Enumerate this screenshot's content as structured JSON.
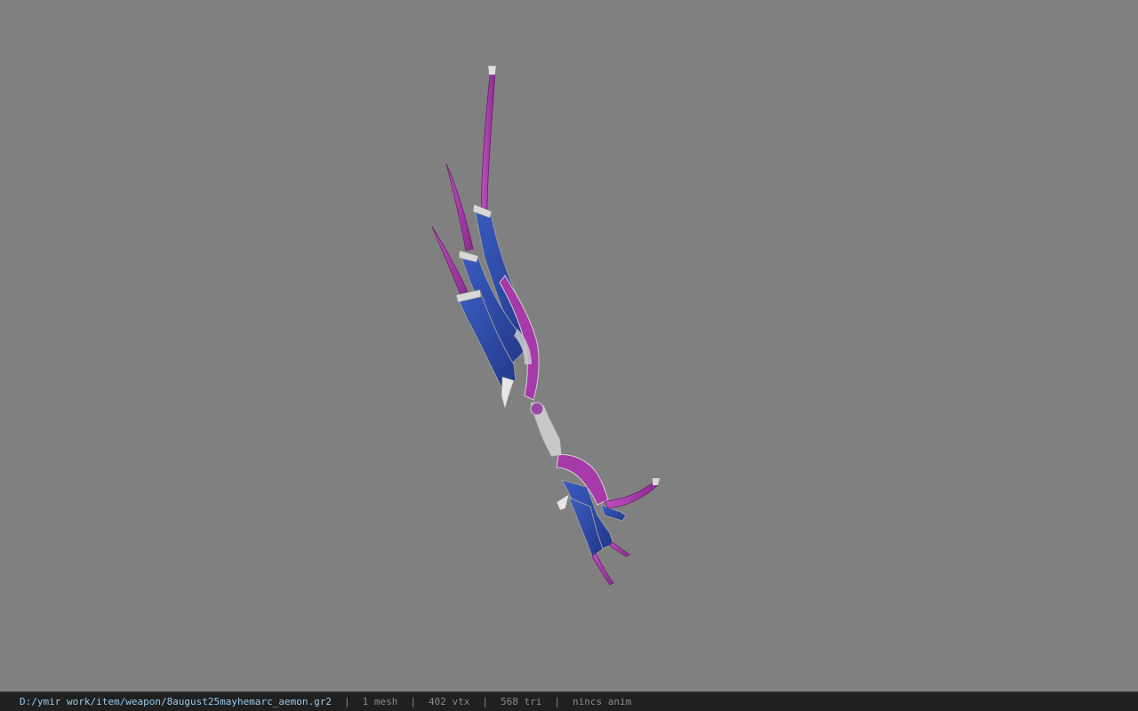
{
  "status_bar": {
    "file_path": "D:/ymir work/item/weapon/8august25mayhemarc_aemon.gr2",
    "separator": "|",
    "mesh_count": "1 mesh",
    "vertex_count": "402 vtx",
    "triangle_count": "568 tri",
    "animation": "nincs anim"
  },
  "colors": {
    "background": "#808080",
    "blade_blue": "#2f4fa8",
    "trim_purple": "#b040b0",
    "metal_silver": "#c8c8c8"
  }
}
